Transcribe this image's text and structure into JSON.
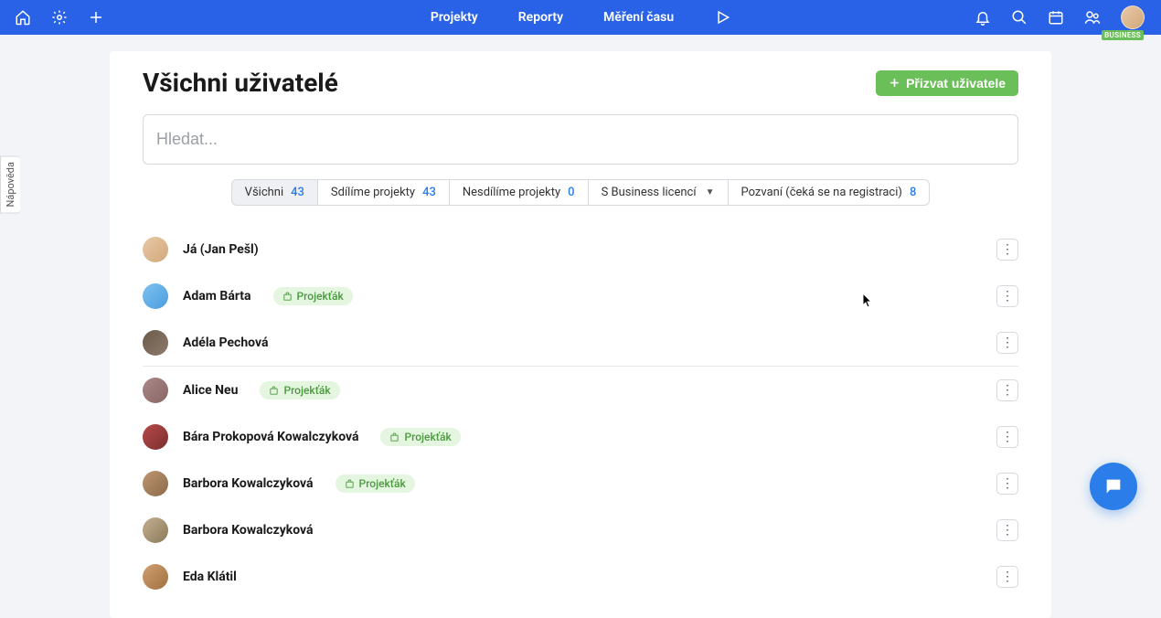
{
  "nav": {
    "items": [
      "Projekty",
      "Reporty",
      "Měření času"
    ],
    "businessBadge": "BUSINESS"
  },
  "page": {
    "title": "Všichni uživatelé",
    "inviteLabel": "Přizvat uživatele",
    "searchPlaceholder": "Hledat...",
    "helpLabel": "Nápověda"
  },
  "tabs": [
    {
      "label": "Všichni",
      "count": "43",
      "active": true
    },
    {
      "label": "Sdílíme projekty",
      "count": "43"
    },
    {
      "label": "Nesdílíme projekty",
      "count": "0"
    },
    {
      "label": "S Business licencí",
      "dropdown": true
    },
    {
      "label": "Pozvaní (čeká se na registraci)",
      "count": "8"
    }
  ],
  "badgeLabel": "Projekťák",
  "users": [
    {
      "name": "Já (Jan Pešl)",
      "badge": false,
      "avatar": "c1"
    },
    {
      "name": "Adam Bárta",
      "badge": true,
      "avatar": "c2"
    },
    {
      "name": "Adéla Pechová",
      "badge": false,
      "avatar": "c3",
      "separator": true
    },
    {
      "name": "Alice Neu",
      "badge": true,
      "avatar": "c4"
    },
    {
      "name": "Bára Prokopová Kowalczyková",
      "badge": true,
      "avatar": "c5"
    },
    {
      "name": "Barbora Kowalczyková",
      "badge": true,
      "avatar": "c6"
    },
    {
      "name": "Barbora Kowalczyková",
      "badge": false,
      "avatar": "c7"
    },
    {
      "name": "Eda Klátil",
      "badge": false,
      "avatar": "c8"
    }
  ]
}
